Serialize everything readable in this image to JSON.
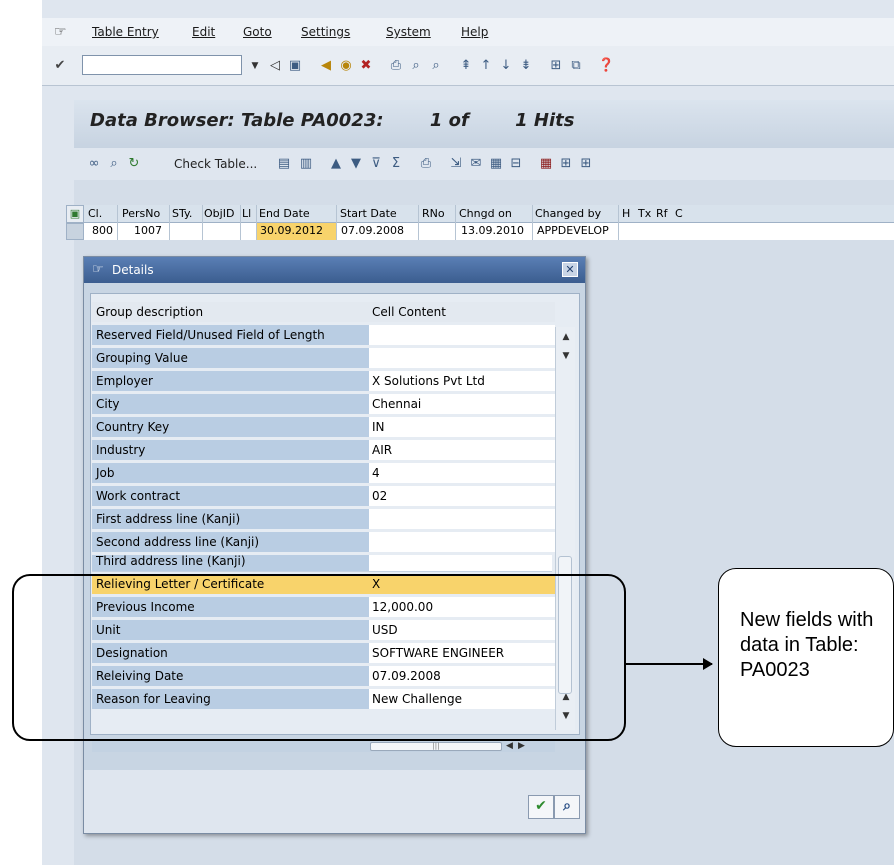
{
  "menu": [
    "Table Entry",
    "Edit",
    "Goto",
    "Settings",
    "System",
    "Help"
  ],
  "toolbar": {
    "command_field_placeholder": ""
  },
  "page": {
    "title": "Data Browser: Table PA0023:",
    "hits_of": "1 of",
    "hits": "1 Hits"
  },
  "app_toolbar": {
    "check_table": "Check Table..."
  },
  "table": {
    "headers": [
      "Cl.",
      "PersNo",
      "STy.",
      "ObjID",
      "Ll",
      "End Date",
      "Start Date",
      "RNo",
      "Chngd on",
      "Changed by",
      "H",
      "Tx",
      "Rf",
      "C"
    ],
    "row": [
      "800",
      "1007",
      "",
      "",
      "",
      "30.09.2012",
      "07.09.2008",
      "",
      "13.09.2010",
      "APPDEVELOP",
      "",
      "",
      "",
      ""
    ]
  },
  "dialog": {
    "title": "Details",
    "col_group": "Group description",
    "col_content": "Cell Content",
    "rows": [
      {
        "label": "Reserved Field/Unused Field of Length",
        "value": ""
      },
      {
        "label": "Grouping Value",
        "value": ""
      },
      {
        "label": "Employer",
        "value": "X Solutions Pvt Ltd"
      },
      {
        "label": "City",
        "value": "Chennai"
      },
      {
        "label": "Country Key",
        "value": "IN"
      },
      {
        "label": "Industry",
        "value": "AIR"
      },
      {
        "label": "Job",
        "value": "4"
      },
      {
        "label": "Work contract",
        "value": "02"
      },
      {
        "label": "First address line (Kanji)",
        "value": ""
      },
      {
        "label": "Second address line (Kanji)",
        "value": ""
      },
      {
        "label": "Third address line (Kanji)",
        "value": ""
      },
      {
        "label": "Relieving Letter / Certificate",
        "value": "X"
      },
      {
        "label": "Previous Income",
        "value": "12,000.00"
      },
      {
        "label": "Unit",
        "value": "USD"
      },
      {
        "label": "Designation",
        "value": "SOFTWARE ENGINEER"
      },
      {
        "label": "Releiving Date",
        "value": "07.09.2008"
      },
      {
        "label": "Reason for Leaving",
        "value": "New Challenge"
      }
    ]
  },
  "annotation": {
    "text": "New fields with data in Table: PA0023"
  },
  "colors": {
    "highlight": "#f8d36b",
    "title_bar": "#3b5d8f",
    "label_bg": "#b9cde3"
  }
}
